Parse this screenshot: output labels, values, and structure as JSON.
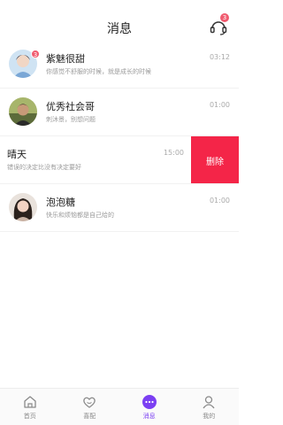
{
  "header": {
    "title": "消息",
    "service_badge": "3"
  },
  "conversations": [
    {
      "name": "紫魅很甜",
      "message": "你感觉不舒服的时候，就是成长的时候",
      "time": "03:12",
      "badge": "3"
    },
    {
      "name": "优秀社会哥",
      "message": "刺沐景，别想问题",
      "time": "01:00"
    },
    {
      "name": "晴天",
      "message": "错误的决定比没有决定要好",
      "time": "15:00",
      "action": "删除"
    },
    {
      "name": "泡泡糖",
      "message": "快乐和烦恼都是自己给的",
      "time": "01:00"
    }
  ],
  "tabbar": {
    "items": [
      {
        "label": "首页",
        "icon": "home-icon"
      },
      {
        "label": "喜配",
        "icon": "heart-icon"
      },
      {
        "label": "消息",
        "icon": "chat-icon",
        "active": true
      },
      {
        "label": "我的",
        "icon": "user-icon"
      }
    ]
  },
  "colors": {
    "accent": "#7b3ff2",
    "delete": "#f42548",
    "badge": "#f05a6e"
  }
}
